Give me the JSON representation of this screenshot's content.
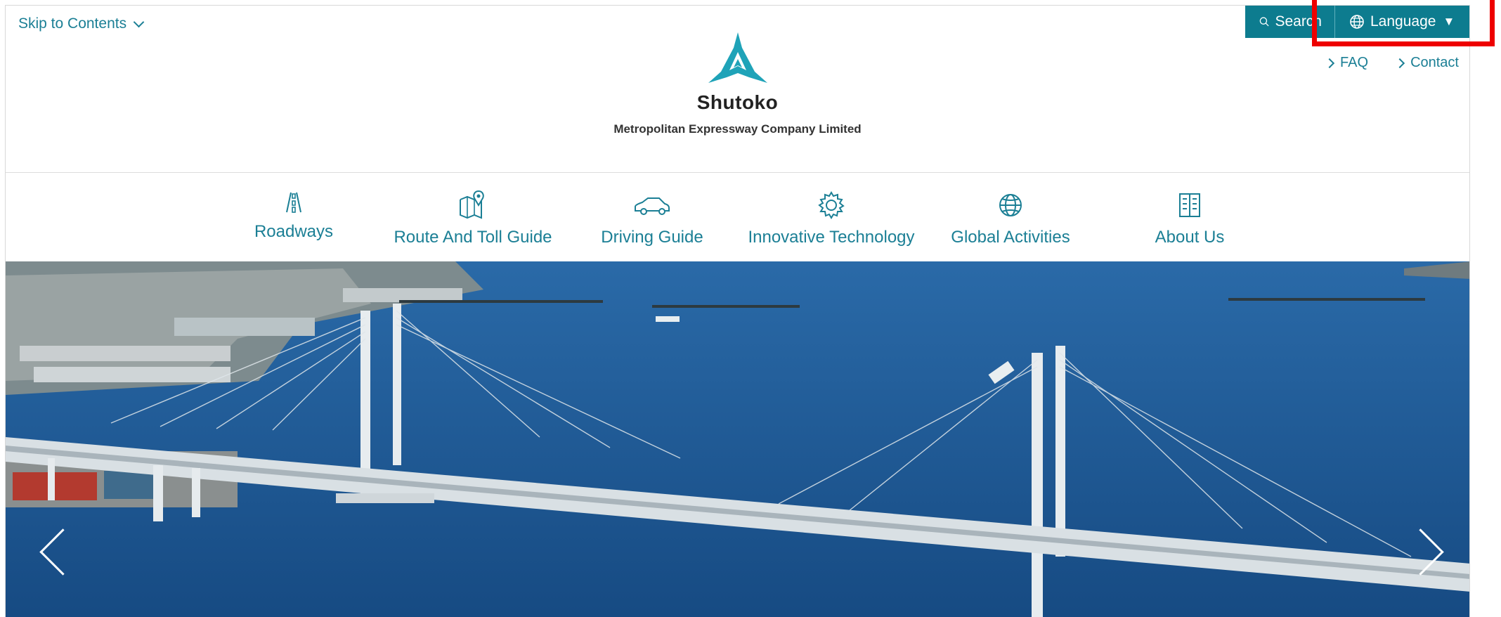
{
  "header": {
    "skip_link": "Skip to Contents",
    "search_label": "Search",
    "language_label": "Language",
    "language_caret": "▼",
    "faq_label": "FAQ",
    "contact_label": "Contact",
    "brand_name": "Shutoko",
    "brand_subtitle": "Metropolitan Expressway Company Limited"
  },
  "nav": {
    "items": [
      {
        "label": "Roadways",
        "icon": "road-icon"
      },
      {
        "label": "Route And Toll Guide",
        "icon": "map-pin-icon"
      },
      {
        "label": "Driving Guide",
        "icon": "car-icon"
      },
      {
        "label": "Innovative Technology",
        "icon": "gear-icon"
      },
      {
        "label": "Global Activities",
        "icon": "globe-icon"
      },
      {
        "label": "About Us",
        "icon": "building-icon"
      }
    ]
  },
  "hero": {
    "image": "bridge-over-harbor"
  },
  "colors": {
    "accent": "#0d7c8f",
    "link": "#1b7f95",
    "annotation": "#ee0000",
    "water": "#1a5794"
  }
}
